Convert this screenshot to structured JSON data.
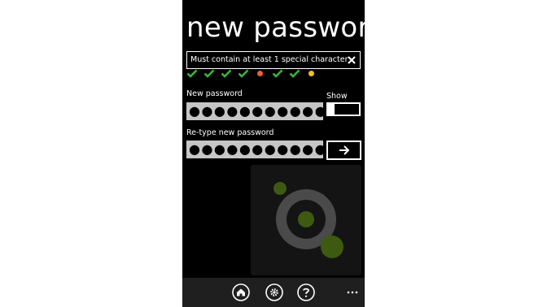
{
  "page": {
    "title": "new password",
    "hint": "Must contain at least 1 special character",
    "new_password_label": "New password",
    "new_password_value": "●●●●●●●●●●●",
    "retype_label": "Re-type new password",
    "retype_value": "●●●●●●●●●●●",
    "show_label": "Show",
    "show_toggle_on": false
  },
  "requirements": [
    {
      "state": "met",
      "color": "#3cb43c"
    },
    {
      "state": "met",
      "color": "#3cb43c"
    },
    {
      "state": "met",
      "color": "#3cb43c"
    },
    {
      "state": "met",
      "color": "#3cb43c"
    },
    {
      "state": "unmet",
      "color": "#e8603c"
    },
    {
      "state": "met",
      "color": "#3cb43c"
    },
    {
      "state": "met",
      "color": "#3cb43c"
    },
    {
      "state": "partial",
      "color": "#f0c020"
    }
  ],
  "app_bar": {
    "buttons": [
      {
        "icon": "home-icon"
      },
      {
        "icon": "gear-icon"
      },
      {
        "icon": "help-icon"
      }
    ],
    "more_icon": "ellipsis-icon"
  },
  "colors": {
    "background": "#000000",
    "input": "#c6c6c6",
    "app_bar": "#1f1f1f",
    "logo_green": "#3d5a10",
    "logo_ring": "#555555"
  }
}
